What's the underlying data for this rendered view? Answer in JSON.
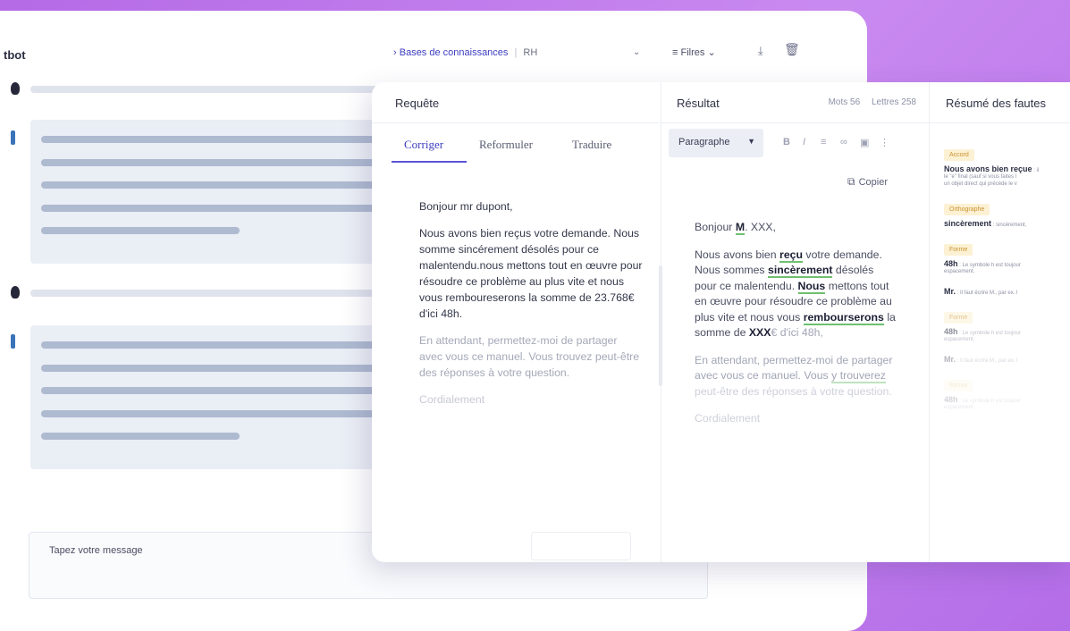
{
  "chat": {
    "title": "tbot",
    "input_placeholder": "Tapez votre message"
  },
  "topbar": {
    "kb_prefix": "›",
    "kb_label": "Bases de connaissances",
    "kb_sep": "|",
    "kb_value": "RH",
    "filters_label": "Filres"
  },
  "request": {
    "title": "Requête",
    "tabs": [
      "Corriger",
      "Reformuler",
      "Traduire"
    ],
    "greeting": "Bonjour mr dupont,",
    "paragraph1": "Nous avons bien reçus votre demande. Nous somme sincérement désolés pour ce malentendu.nous mettons tout en œuvre pour résoudre ce problème au plus vite et nous vous remboureserons la somme de 23.768€ d'ici 48h.",
    "paragraph2": "En attendant, permettez-moi de partager avec vous ce manuel. Vous trouvez peut-être des réponses à votre question.",
    "closing": "Cordialement"
  },
  "result": {
    "title": "Résultat",
    "words_label": "Mots 56",
    "letters_label": "Lettres 258",
    "paragraph_style": "Paragraphe",
    "copy_label": "Copier",
    "greeting_pre": "Bonjour ",
    "greeting_fix": "M",
    "greeting_post": ". XXX,",
    "p1_a": "Nous avons bien ",
    "p1_fix1": "reçu",
    "p1_b": " votre demande. Nous sommes ",
    "p1_fix2": "sincèrement",
    "p1_c": " désolés pour ce malentendu. ",
    "p1_fix3": "Nous",
    "p1_d": " mettons tout en œuvre pour résoudre ce problème au plus vite et nous vous ",
    "p1_fix4": "rembourserons",
    "p1_e": " la somme de ",
    "p1_fix5": "XXX",
    "p1_f": "€ d'ici 48h,",
    "p2_a": "En attendant, permettez-moi de partager avec vous ce manuel. Vous ",
    "p2_fix": "y trouverez",
    "p2_b": " peut-être des réponses à votre question.",
    "closing": "Cordialement"
  },
  "summary": {
    "title": "Résumé des fautes",
    "items": [
      {
        "badge": "Accord",
        "term": "Nous avons bien reçue",
        "note": " : il",
        "sub1": "le \"e\" final (sauf si vous faites l",
        "sub2": "un objet direct qui précède le v"
      },
      {
        "badge": "Orthographe",
        "term": "sincèrement",
        "note": " : sincèrement,"
      },
      {
        "badge": "Forme",
        "term": "48h",
        "note": " : Le symbole h est toujour",
        "sub1": "espacement."
      },
      {
        "term": "Mr.",
        "note": " : Il faut écrire M., par ex. l"
      },
      {
        "badge": "Forme",
        "term": "48h",
        "note": " : Le symbole h est toujour",
        "sub1": "espacement."
      },
      {
        "term": "Mr.",
        "note": " : Il faut écrire M., par ex. l"
      },
      {
        "badge": "Forme",
        "term": "48h",
        "note": " : Le symbole h est toujour",
        "sub1": "espacement."
      }
    ]
  },
  "colors": {
    "accent": "#3b3dbf",
    "background": "#c27fee",
    "correction_underline": "#6ec06e"
  }
}
